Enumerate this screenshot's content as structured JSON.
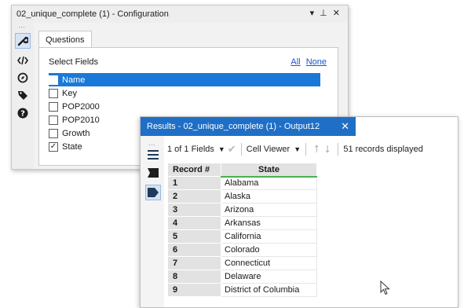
{
  "config": {
    "title": "02_unique_complete (1) - Configuration",
    "window_controls": "▾ ⊥ ✕",
    "rail_dots": "⋯",
    "tab_label": "Questions",
    "select_label": "Select Fields",
    "link_all": "All",
    "link_none": "None",
    "fields": [
      {
        "label": "Name",
        "checked": false,
        "selected": true
      },
      {
        "label": "Key",
        "checked": false,
        "selected": false
      },
      {
        "label": "POP2000",
        "checked": false,
        "selected": false
      },
      {
        "label": "POP2010",
        "checked": false,
        "selected": false
      },
      {
        "label": "Growth",
        "checked": false,
        "selected": false
      },
      {
        "label": "State",
        "checked": true,
        "selected": false
      }
    ]
  },
  "results": {
    "title": "Results - 02_unique_complete (1) - Output12",
    "close_glyph": "✕",
    "rail_dots": "⋯",
    "toolbar": {
      "fields_label": "1 of 1 Fields",
      "viewer_label": "Cell Viewer",
      "records_label": "51 records displayed"
    },
    "columns": [
      "Record #",
      "State"
    ],
    "rows": [
      {
        "record": "1",
        "state": "Alabama"
      },
      {
        "record": "2",
        "state": "Alaska"
      },
      {
        "record": "3",
        "state": "Arizona"
      },
      {
        "record": "4",
        "state": "Arkansas"
      },
      {
        "record": "5",
        "state": "California"
      },
      {
        "record": "6",
        "state": "Colorado"
      },
      {
        "record": "7",
        "state": "Connecticut"
      },
      {
        "record": "8",
        "state": "Delaware"
      },
      {
        "record": "9",
        "state": "District of Columbia"
      }
    ]
  },
  "colors": {
    "accent": "#1f6fc6",
    "selection": "#1a78d8",
    "link": "#1a55c8",
    "header_underline": "#4caf50"
  }
}
